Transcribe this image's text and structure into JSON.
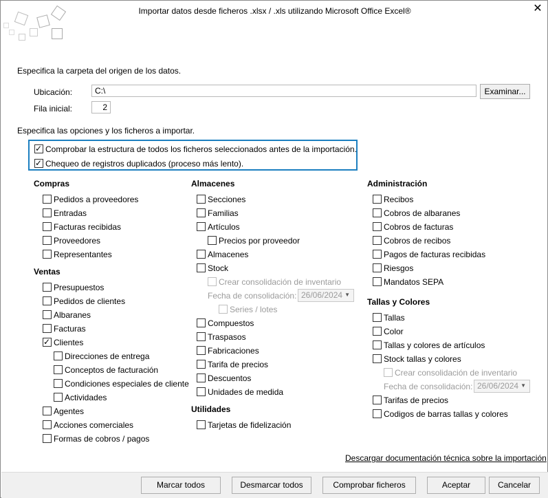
{
  "window": {
    "title": "Importar datos desde ficheros .xlsx / .xls utilizando Microsoft Office Excel®",
    "close_icon": "close-icon"
  },
  "source": {
    "heading": "Especifica la carpeta del origen de los datos.",
    "location_label": "Ubicación:",
    "location_value": "C:\\",
    "browse_label": "Examinar...",
    "start_row_label": "Fila inicial:",
    "start_row_value": "2"
  },
  "options": {
    "heading": "Especifica las opciones y los ficheros a importar.",
    "check_structure": "Comprobar la estructura de todos los ficheros seleccionados antes de la importación.",
    "check_duplicates": "Chequeo de registros duplicados (proceso más lento)."
  },
  "compras": {
    "title": "Compras",
    "items": [
      "Pedidos a proveedores",
      "Entradas",
      "Facturas recibidas",
      "Proveedores",
      "Representantes"
    ]
  },
  "ventas": {
    "title": "Ventas",
    "items": [
      "Presupuestos",
      "Pedidos de clientes",
      "Albaranes",
      "Facturas",
      "Clientes"
    ],
    "clientes_sub": [
      "Direcciones de entrega",
      "Conceptos de facturación",
      "Condiciones especiales de cliente",
      "Actividades"
    ],
    "items2": [
      "Agentes",
      "Acciones comerciales",
      "Formas de cobros / pagos"
    ]
  },
  "almacenes": {
    "title": "Almacenes",
    "items": [
      "Secciones",
      "Familias",
      "Artículos"
    ],
    "precios_proveedor": "Precios por proveedor",
    "items2": [
      "Almacenes",
      "Stock"
    ],
    "crear_consolidacion": "Crear consolidación de inventario",
    "fecha_label": "Fecha de consolidación:",
    "fecha_value": "26/06/2024",
    "series_lotes": "Series / lotes",
    "items3": [
      "Compuestos",
      "Traspasos",
      "Fabricaciones",
      "Tarifa de precios",
      "Descuentos",
      "Unidades de medida"
    ]
  },
  "utilidades": {
    "title": "Utilidades",
    "items": [
      "Tarjetas de fidelización"
    ]
  },
  "administracion": {
    "title": "Administración",
    "items": [
      "Recibos",
      "Cobros de albaranes",
      "Cobros de facturas",
      "Cobros de recibos",
      "Pagos de facturas recibidas",
      "Riesgos",
      "Mandatos SEPA"
    ]
  },
  "tallas": {
    "title": "Tallas y Colores",
    "items": [
      "Tallas",
      "Color",
      "Tallas y colores de artículos",
      "Stock tallas y colores"
    ],
    "crear_consolidacion": "Crear consolidación de inventario",
    "fecha_label": "Fecha de consolidación:",
    "fecha_value": "26/06/2024",
    "items2": [
      "Tarifas de precios",
      "Codigos de barras tallas y colores"
    ]
  },
  "doc_link": "Descargar documentación técnica sobre la importación",
  "buttons": {
    "mark_all": "Marcar todos",
    "unmark_all": "Desmarcar todos",
    "check_files": "Comprobar ficheros",
    "accept": "Aceptar",
    "cancel": "Cancelar"
  },
  "colors": {
    "focus": "#1c7fc0",
    "footer": "#f0f0f0"
  }
}
